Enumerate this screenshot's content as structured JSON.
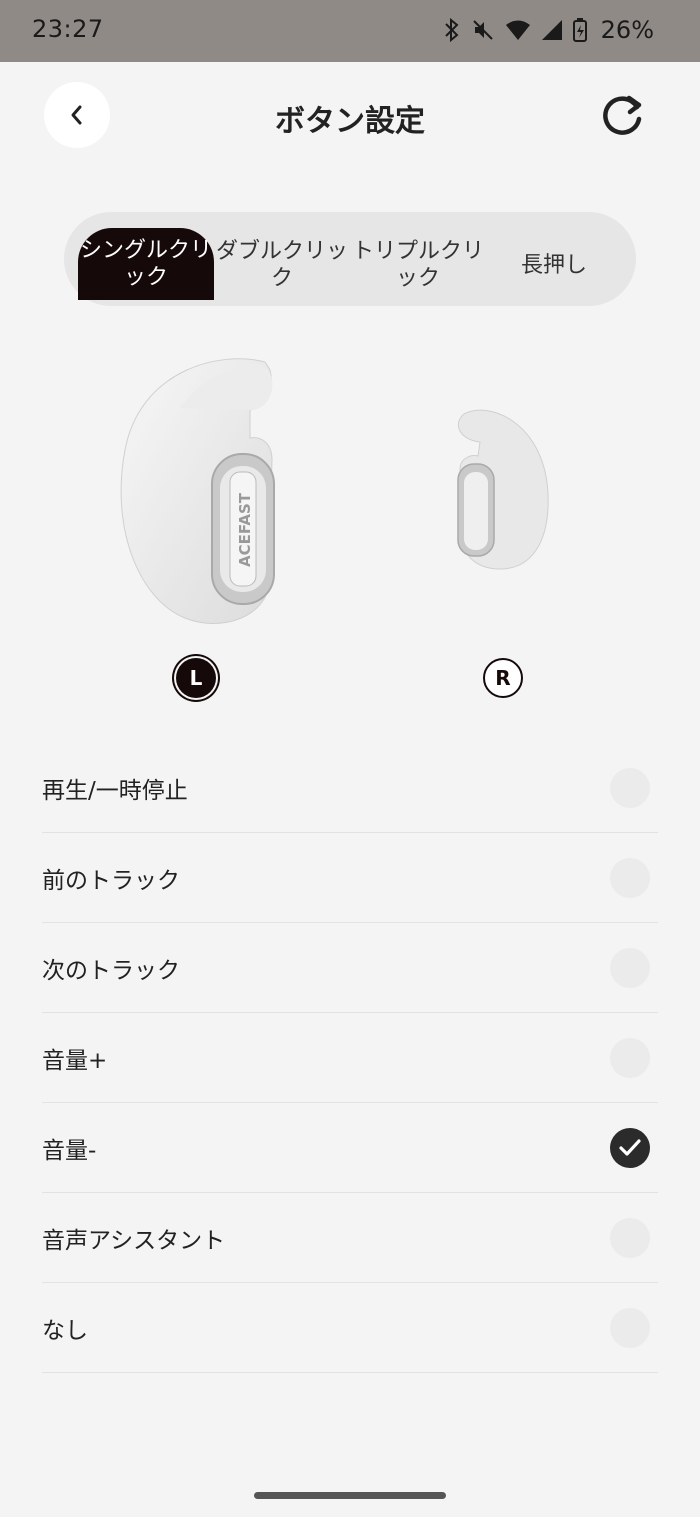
{
  "status_bar": {
    "time": "23:27",
    "battery": "26%"
  },
  "header": {
    "title": "ボタン設定"
  },
  "tabs": [
    {
      "label": "シングルクリック",
      "active": true
    },
    {
      "label": "ダブルクリック",
      "active": false
    },
    {
      "label": "トリプルクリック",
      "active": false
    },
    {
      "label": "長押し",
      "active": false
    }
  ],
  "earbuds": {
    "left_badge": "L",
    "right_badge": "R",
    "brand": "ACEFAST",
    "selected": "L"
  },
  "options": [
    {
      "label": "再生/一時停止",
      "checked": false
    },
    {
      "label": "前のトラック",
      "checked": false
    },
    {
      "label": "次のトラック",
      "checked": false
    },
    {
      "label": "音量+",
      "checked": false
    },
    {
      "label": "音量-",
      "checked": true
    },
    {
      "label": "音声アシスタント",
      "checked": false
    },
    {
      "label": "なし",
      "checked": false
    }
  ],
  "colors": {
    "accent": "#150909",
    "status_bar": "#8f8a86",
    "background": "#f4f4f4"
  }
}
